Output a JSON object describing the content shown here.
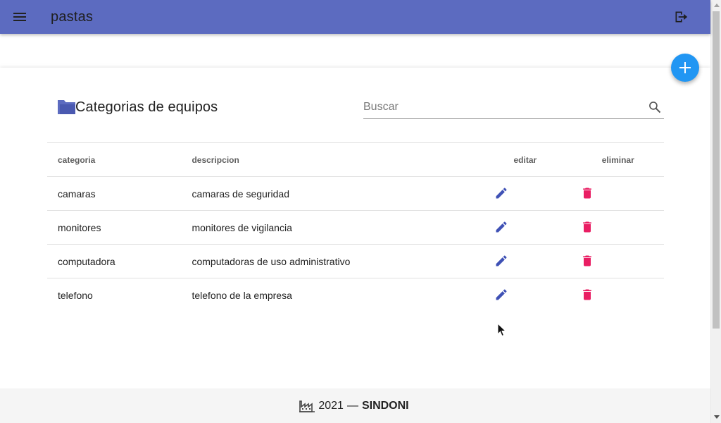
{
  "app_bar": {
    "title": "pastas",
    "menu_icon": "menu-icon",
    "logout_icon": "logout-icon",
    "color": "#5c6bc0"
  },
  "fab": {
    "icon": "plus-icon",
    "color": "#2196f3"
  },
  "card": {
    "title": "Categorias de equipos",
    "title_icon": "folder-icon",
    "search": {
      "placeholder": "Buscar",
      "value": "",
      "icon": "search-icon"
    }
  },
  "table": {
    "headers": {
      "categoria": "categoria",
      "descripcion": "descripcion",
      "editar": "editar",
      "eliminar": "eliminar"
    },
    "rows": [
      {
        "categoria": "camaras",
        "descripcion": "camaras de seguridad"
      },
      {
        "categoria": "monitores",
        "descripcion": "monitores de vigilancia"
      },
      {
        "categoria": "computadora",
        "descripcion": "computadoras de uso administrativo"
      },
      {
        "categoria": "telefono",
        "descripcion": "telefono de la empresa"
      }
    ],
    "edit_icon": "pencil-icon",
    "delete_icon": "trash-icon",
    "edit_color": "#3f51b5",
    "delete_color": "#e91e63"
  },
  "footer": {
    "icon": "factory-icon",
    "year": "2021",
    "separator": "—",
    "brand": "SINDONI"
  }
}
